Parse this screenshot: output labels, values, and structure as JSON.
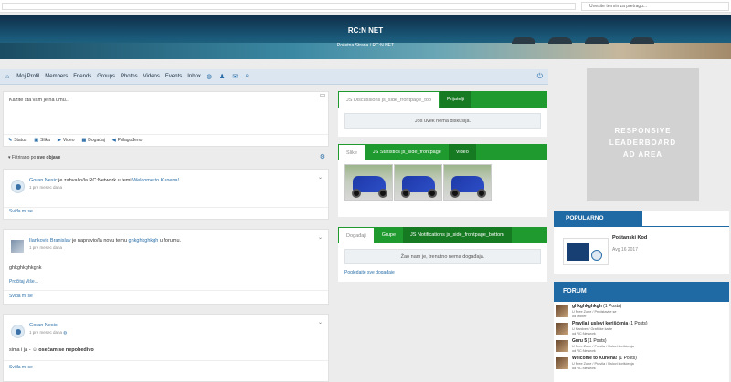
{
  "topbar": {
    "search_placeholder": "Unesite termin za pretragu..."
  },
  "hero": {
    "title": "RC:N NET",
    "breadcrumb": "Početna Strana  /  RC:N NET"
  },
  "nav": {
    "items": [
      "Moj Profil",
      "Members",
      "Friends",
      "Groups",
      "Photos",
      "Videos",
      "Events",
      "Inbox"
    ]
  },
  "composer": {
    "placeholder": "Kažite šta vam je na umu...",
    "tools": [
      "Status",
      "Slika",
      "Video",
      "Događaj",
      "Prilagođeno"
    ]
  },
  "filter": {
    "prefix": "Filtrirano po",
    "value": "sve objave"
  },
  "posts": [
    {
      "author": "Goran Nesic",
      "action": "je zahvalio/la RC:Network u temi",
      "target": "Welcome to Kunena!",
      "author2": "RC:Network",
      "time": "1 pre mesec dana",
      "like": "Sviđa mi se"
    },
    {
      "author": "Ilankovic Branislav",
      "action": "je napravio/la novu temu",
      "target": "ghkghkghkgh",
      "suffix": "u forumu.",
      "time": "1 pre mesec dana",
      "body": "ghkghkghkghk",
      "more": "Pročitaj Više...",
      "like": "Sviđa mi se"
    },
    {
      "author": "Goran Nesic",
      "time": "1 pre mesec dana",
      "body_pre": "sima i ja -",
      "body_bold": "osećam se nepobedivo",
      "like": "Sviđa mi se"
    }
  ],
  "discussions": {
    "tabs": [
      "JS Discussions js_side_frontpage_top",
      "Prijatelji"
    ],
    "message": "Još uvek nema diskusija."
  },
  "media": {
    "tabs": [
      "Slike",
      "JS Statistics js_side_frontpage",
      "Video"
    ]
  },
  "events": {
    "tabs": [
      "Događaji",
      "Grupe",
      "JS Notifications js_side_frontpage_bottom"
    ],
    "message": "Žao nam je, trenutno nema događaja.",
    "see_all": "Pogledajte sve događaje"
  },
  "ad": {
    "line1": "RESPONSIVE",
    "line2": "LEADERBOARD",
    "line3": "AD AREA"
  },
  "popular": {
    "header": "POPULARNO",
    "title": "Poštanski Kod",
    "date": "Avg 16 2017"
  },
  "forum": {
    "header": "FORUM",
    "rows": [
      {
        "title": "ghkghkghkgh",
        "posts": "(1 Posts)",
        "sub1": "U Free Zone / Predstavite se",
        "sub2": "od Milner"
      },
      {
        "title": "Pravila i uslovi korišćenja",
        "posts": "(1 Posts)",
        "sub1": "U Hardver / Grafičke karte",
        "sub2": "od RC:Network"
      },
      {
        "title": "Guru 5",
        "posts": "(1 Posts)",
        "sub1": "U Free Zone / Pravila / Uslovi korišćenja",
        "sub2": "od RC:Network"
      },
      {
        "title": "Welcome to Kunena!",
        "posts": "(1 Posts)",
        "sub1": "U Free Zone / Pravila / Uslovi korišćenja",
        "sub2": "od RC:Network"
      }
    ]
  },
  "colors": {
    "accent_blue": "#1f6aa5",
    "accent_green": "#1f9a2e",
    "nav_bg": "#dbe6f0"
  }
}
